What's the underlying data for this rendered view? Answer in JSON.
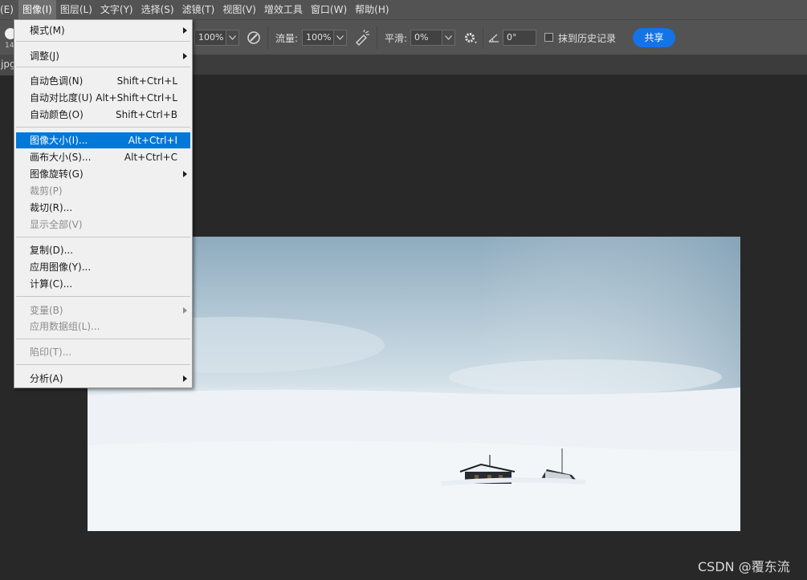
{
  "menubar": {
    "items": [
      "(E)",
      "图像(I)",
      "图层(L)",
      "文字(Y)",
      "选择(S)",
      "滤镜(T)",
      "视图(V)",
      "增效工具",
      "窗口(W)",
      "帮助(H)"
    ]
  },
  "options": {
    "brush_size": "14",
    "opacity_value": "100%",
    "flow_label": "流量:",
    "flow_value": "100%",
    "smooth_label": "平滑:",
    "smooth_value": "0%",
    "angle_value": "0°",
    "erase_history_label": "抹到历史记录",
    "share_label": "共享"
  },
  "tab": {
    "label": "jpg"
  },
  "image_menu": {
    "items": [
      {
        "label": "模式(M)",
        "shortcut": "",
        "submenu": true,
        "disabled": false
      },
      {
        "label": "调整(J)",
        "shortcut": "",
        "submenu": true,
        "disabled": false
      },
      {
        "label": "自动色调(N)",
        "shortcut": "Shift+Ctrl+L",
        "submenu": false,
        "disabled": false
      },
      {
        "label": "自动对比度(U)",
        "shortcut": "Alt+Shift+Ctrl+L",
        "submenu": false,
        "disabled": false
      },
      {
        "label": "自动颜色(O)",
        "shortcut": "Shift+Ctrl+B",
        "submenu": false,
        "disabled": false
      },
      {
        "label": "图像大小(I)...",
        "shortcut": "Alt+Ctrl+I",
        "submenu": false,
        "disabled": false,
        "highlighted": true
      },
      {
        "label": "画布大小(S)...",
        "shortcut": "Alt+Ctrl+C",
        "submenu": false,
        "disabled": false
      },
      {
        "label": "图像旋转(G)",
        "shortcut": "",
        "submenu": true,
        "disabled": false
      },
      {
        "label": "裁剪(P)",
        "shortcut": "",
        "submenu": false,
        "disabled": true
      },
      {
        "label": "裁切(R)...",
        "shortcut": "",
        "submenu": false,
        "disabled": false
      },
      {
        "label": "显示全部(V)",
        "shortcut": "",
        "submenu": false,
        "disabled": true
      },
      {
        "label": "复制(D)...",
        "shortcut": "",
        "submenu": false,
        "disabled": false
      },
      {
        "label": "应用图像(Y)...",
        "shortcut": "",
        "submenu": false,
        "disabled": false
      },
      {
        "label": "计算(C)...",
        "shortcut": "",
        "submenu": false,
        "disabled": false
      },
      {
        "label": "变量(B)",
        "shortcut": "",
        "submenu": true,
        "disabled": true
      },
      {
        "label": "应用数据组(L)...",
        "shortcut": "",
        "submenu": false,
        "disabled": true
      },
      {
        "label": "陷印(T)...",
        "shortcut": "",
        "submenu": false,
        "disabled": true
      },
      {
        "label": "分析(A)",
        "shortcut": "",
        "submenu": true,
        "disabled": false
      }
    ]
  },
  "watermark": "CSDN @覆东流",
  "colors": {
    "menu_highlight": "#0078d7",
    "share_button": "#1473e6",
    "workspace_bg": "#282828",
    "toolbar_bg": "#535353"
  }
}
